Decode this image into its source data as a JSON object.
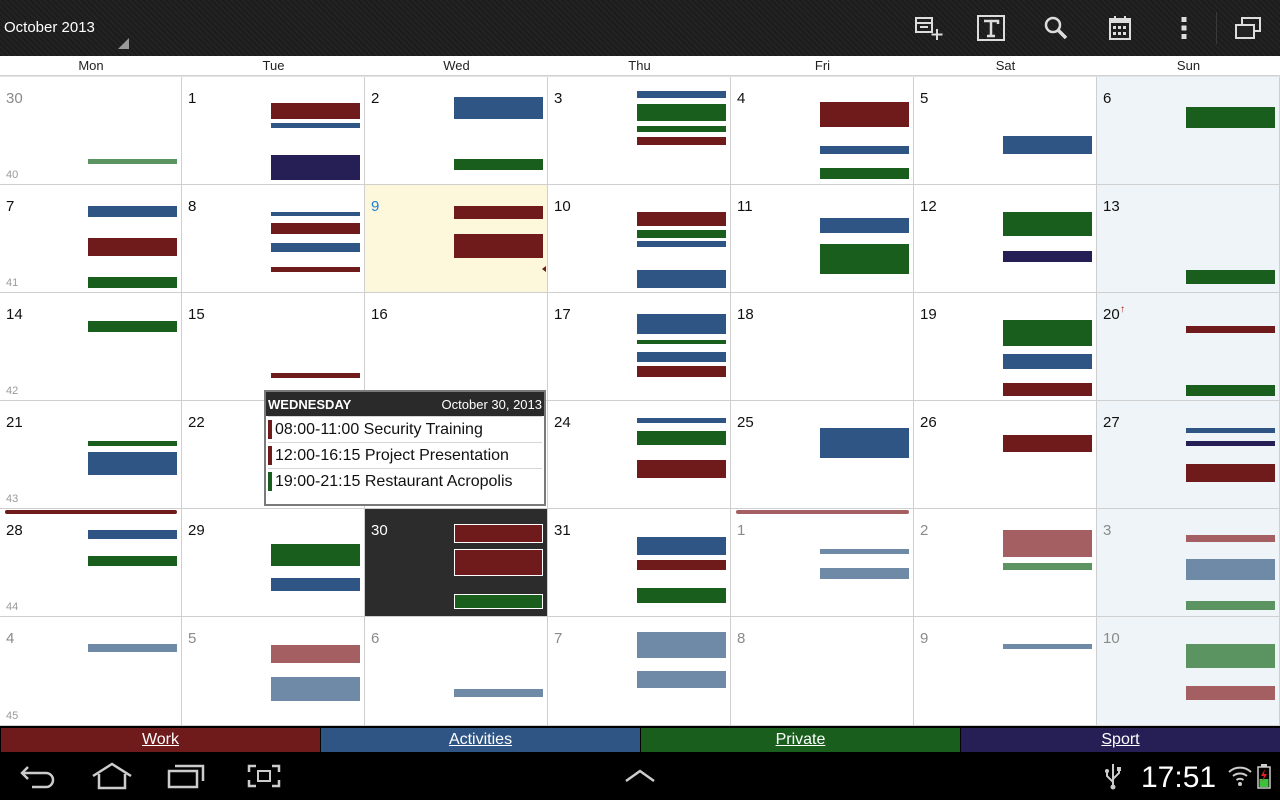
{
  "app": {
    "month_title": "October 2013",
    "toolbar": [
      {
        "name": "new-event-icon"
      },
      {
        "name": "text-view-icon"
      },
      {
        "name": "search-icon"
      },
      {
        "name": "calendar-icon"
      },
      {
        "name": "overflow-menu-icon"
      },
      {
        "name": "window-icon"
      }
    ]
  },
  "colors": {
    "work": "#6f1a1b",
    "activities": "#2e5584",
    "private": "#1a5e1d",
    "sport": "#261f55",
    "work_light": "#a35f61",
    "activities_light": "#6e8aa7",
    "private_light": "#5b9461",
    "sport_light": "#6a6590"
  },
  "weekdays": [
    "Mon",
    "Tue",
    "Wed",
    "Thu",
    "Fri",
    "Sat",
    "Sun"
  ],
  "weeks": [
    {
      "week_number": "40",
      "days": [
        "30",
        "1",
        "2",
        "3",
        "4",
        "5",
        "6"
      ]
    },
    {
      "week_number": "41",
      "days": [
        "7",
        "8",
        "9",
        "10",
        "11",
        "12",
        "13"
      ]
    },
    {
      "week_number": "42",
      "days": [
        "14",
        "15",
        "16",
        "17",
        "18",
        "19",
        "20"
      ]
    },
    {
      "week_number": "43",
      "days": [
        "21",
        "22",
        "23",
        "24",
        "25",
        "26",
        "27"
      ]
    },
    {
      "week_number": "44",
      "days": [
        "28",
        "29",
        "30",
        "31",
        "1",
        "2",
        "3"
      ]
    },
    {
      "week_number": "45",
      "days": [
        "4",
        "5",
        "6",
        "7",
        "8",
        "9",
        "10"
      ]
    }
  ],
  "popup": {
    "weekday": "WEDNESDAY",
    "date": "October 30, 2013",
    "events": [
      {
        "time": "08:00-11:00",
        "title": "Security Training",
        "category": "work"
      },
      {
        "time": "12:00-16:15",
        "title": "Project Presentation",
        "category": "work"
      },
      {
        "time": "19:00-21:15",
        "title": "Restaurant Acropolis",
        "category": "private"
      }
    ]
  },
  "legend": [
    {
      "label": "Work",
      "category": "work"
    },
    {
      "label": "Activities",
      "category": "activities"
    },
    {
      "label": "Private",
      "category": "private"
    },
    {
      "label": "Sport",
      "category": "sport"
    }
  ],
  "status": {
    "time": "17:51"
  }
}
